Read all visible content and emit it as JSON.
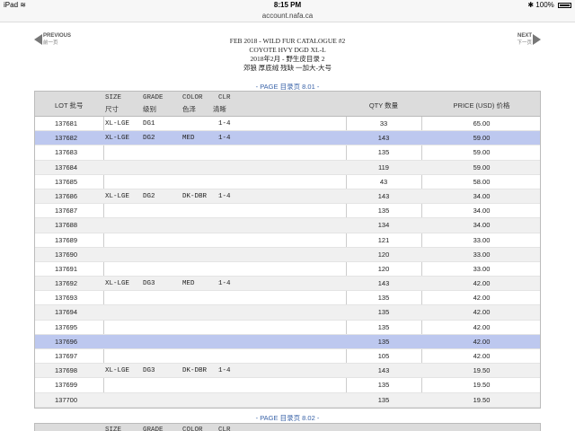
{
  "status_bar": {
    "device": "iPad",
    "wifi": "wifi",
    "time": "8:15 PM",
    "bluetooth": "✱",
    "battery": "100%"
  },
  "url_bar": {
    "url": "account.nafa.ca"
  },
  "nav": {
    "prev_en": "PREVIOUS",
    "prev_cn": "前一页",
    "next_en": "NEXT",
    "next_cn": "下一页"
  },
  "catalogue": {
    "line1": "FEB 2018 - WILD FUR CATALOGUE #2",
    "line2": "COYOTE HVY DGD XL-L",
    "line3": "2018年2月 - 野生皮目录 2",
    "line4": "郊狼 厚底绒 残缺 一加大-大号"
  },
  "page_marker_1": "- PAGE 目录页 8.01 -",
  "page_marker_2": "- PAGE 目录页 8.02 -",
  "table_headers": {
    "lot": "LOT 批号",
    "size": "SIZE",
    "size_cn": "尺寸",
    "grade": "GRADE",
    "grade_cn": "级别",
    "color": "COLOR",
    "color_cn": "色泽",
    "clr": "CLR",
    "clr_cn": "清晰",
    "qty": "QTY 数量",
    "price": "PRICE (USD) 价格"
  },
  "rows": [
    {
      "lot": "137681",
      "size": "XL-LGE",
      "grade": "DG1",
      "color": "",
      "clr": "1-4",
      "qty": "33",
      "price": "65.00",
      "highlight": false
    },
    {
      "lot": "137682",
      "size": "XL-LGE",
      "grade": "DG2",
      "color": "MED",
      "clr": "1-4",
      "qty": "143",
      "price": "59.00",
      "highlight": true
    },
    {
      "lot": "137683",
      "size": "",
      "grade": "",
      "color": "",
      "clr": "",
      "qty": "135",
      "price": "59.00",
      "highlight": false
    },
    {
      "lot": "137684",
      "size": "",
      "grade": "",
      "color": "",
      "clr": "",
      "qty": "119",
      "price": "59.00",
      "highlight": false
    },
    {
      "lot": "137685",
      "size": "",
      "grade": "",
      "color": "",
      "clr": "",
      "qty": "43",
      "price": "58.00",
      "highlight": false
    },
    {
      "lot": "137686",
      "size": "XL-LGE",
      "grade": "DG2",
      "color": "DK-DBR",
      "clr": "1-4",
      "qty": "143",
      "price": "34.00",
      "highlight": false
    },
    {
      "lot": "137687",
      "size": "",
      "grade": "",
      "color": "",
      "clr": "",
      "qty": "135",
      "price": "34.00",
      "highlight": false
    },
    {
      "lot": "137688",
      "size": "",
      "grade": "",
      "color": "",
      "clr": "",
      "qty": "134",
      "price": "34.00",
      "highlight": false
    },
    {
      "lot": "137689",
      "size": "",
      "grade": "",
      "color": "",
      "clr": "",
      "qty": "121",
      "price": "33.00",
      "highlight": false
    },
    {
      "lot": "137690",
      "size": "",
      "grade": "",
      "color": "",
      "clr": "",
      "qty": "120",
      "price": "33.00",
      "highlight": false
    },
    {
      "lot": "137691",
      "size": "",
      "grade": "",
      "color": "",
      "clr": "",
      "qty": "120",
      "price": "33.00",
      "highlight": false
    },
    {
      "lot": "137692",
      "size": "XL-LGE",
      "grade": "DG3",
      "color": "MED",
      "clr": "1-4",
      "qty": "143",
      "price": "42.00",
      "highlight": false
    },
    {
      "lot": "137693",
      "size": "",
      "grade": "",
      "color": "",
      "clr": "",
      "qty": "135",
      "price": "42.00",
      "highlight": false
    },
    {
      "lot": "137694",
      "size": "",
      "grade": "",
      "color": "",
      "clr": "",
      "qty": "135",
      "price": "42.00",
      "highlight": false
    },
    {
      "lot": "137695",
      "size": "",
      "grade": "",
      "color": "",
      "clr": "",
      "qty": "135",
      "price": "42.00",
      "highlight": false
    },
    {
      "lot": "137696",
      "size": "",
      "grade": "",
      "color": "",
      "clr": "",
      "qty": "135",
      "price": "42.00",
      "highlight": true
    },
    {
      "lot": "137697",
      "size": "",
      "grade": "",
      "color": "",
      "clr": "",
      "qty": "105",
      "price": "42.00",
      "highlight": false
    },
    {
      "lot": "137698",
      "size": "XL-LGE",
      "grade": "DG3",
      "color": "DK-DBR",
      "clr": "1-4",
      "qty": "143",
      "price": "19.50",
      "highlight": false
    },
    {
      "lot": "137699",
      "size": "",
      "grade": "",
      "color": "",
      "clr": "",
      "qty": "135",
      "price": "19.50",
      "highlight": false
    },
    {
      "lot": "137700",
      "size": "",
      "grade": "",
      "color": "",
      "clr": "",
      "qty": "135",
      "price": "19.50",
      "highlight": false
    }
  ],
  "colors": {
    "highlight_row": "#bdc8ef",
    "alt_row": "#f0f0f0",
    "header_bg": "#dcdcdc",
    "page_marker": "#3a63a8"
  }
}
